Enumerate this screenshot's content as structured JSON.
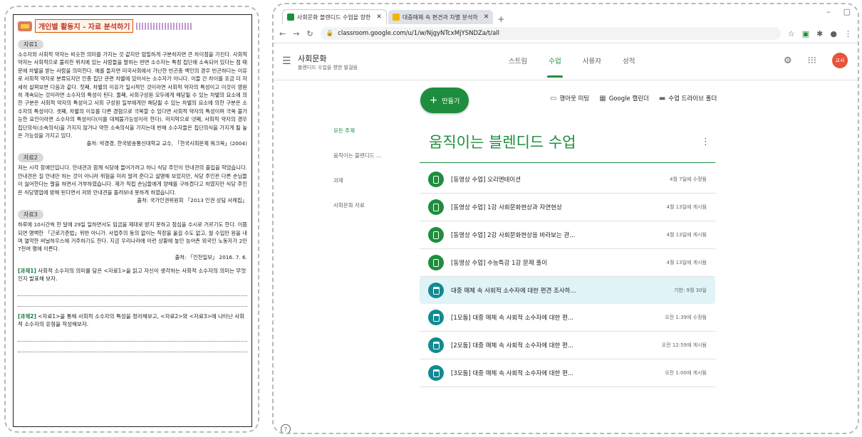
{
  "worksheet": {
    "title": "개인별 활동지 - 자료 분석하기",
    "material1_tag": "자료1",
    "material1_text": "소수자와 사회적 약자는 비슷한 의미를 가지는 것 같지만 엄밀하게 구분하자면 큰 차이점을 가진다. 사회적 약자는 사회적으로 불리한 위치에 있는 사람들을 말하는 반면 소수자는 특정 집단에 소속되어 있다는 점 때문에 차별을 받는 사람을 의미한다. 예를 들자면 미국사회에서 가난한 빈곤층 백인의 경우 빈곤하다는 이유로 사회적 약자로 분류되지만 인종 집단 관련 차별에 있어서는 소수자가 아니다. 이들 간 차이를 조금 더 자세히 살펴보면 다음과 같다. 첫째, 차별의 이유가 일시적인 것이라면 사회적 약자의 특성이고 이것이 영원히 계속되는 것이라면 소수자의 특성이 된다. 둘째, 사회구성원 모두에게 해당될 수 있는 차별의 요소에 의한 구분은 사회적 약자의 특성이고 사회 구성원 일부에게만 해당될 수 있는 차별의 요소에 의한 구분은 소수자의 특성이다. 셋째, 차별의 이유를 다른 경험으로 극복할 수 있다면 사회적 약자의 특성이며 극복 불가능한 요인이라면 소수자의 특성이다(이를 대체불가능성이라 한다). 마지막으로 넷째, 사회적 약자의 경우 집단의식(소속의식)을 가지지 않거나 약한 소속의식을 가지는데 반해 소수자들은 집단의식을 가지게 될 높은 가능성을 가지고 있다.",
    "material1_source": "출처: 박경경, 한국방송통신대학교 교수, 「한국사회문제 워크북」(2004)",
    "material2_tag": "자료2",
    "material2_text": "저는 시각 장애인입니다. 안내견과 함께 식당에 들어가려고 하니 식당 주인이 안내견의 출입을 막았습니다. 안내견은 길 안내만 하는 것이 아니라 위험을 미리 알려 준다고 설명해 보았지만, 식당 주인은 다른 손님들이 싫어한다는 말을 하면서 거부하였습니다. 제가 직접 손님들에게 양해를 구하겠다고 하였지만 식당 주인은 식당영업에 방해 된다면서 저와 안내견을 돌려보내 못하게 하였습니다.",
    "material2_source": "출처: 국가인권위원회 「2013 인권 상담 사례집」",
    "material3_tag": "자료3",
    "material3_text": "하루에 10시간씩 한 달에 29일 일하면서도 임금을 제대로 받지 못하고 점심을 수시로 거르기도 한다. 이쯤되면 명백한 「근로기준법」위반 아니가. 사업주의 동의 없이는 직장을 옮길 수도 없고, 월 수입만 원을 내며 열악한 비닐하우스에 거주하기도 한다. 지금 우리나라에 이런 상황에 놓인 농어촌 외국인 노동자가 2만 7천여 명에 이른다.",
    "material3_source": "출처: 「인천일보」 2016. 7. 6.",
    "task1_label": "[과제1]",
    "task1_text": "사회적 소수자의 의미를 담은 <자료1>을 읽고 자신이 생각하는 사회적 소수자의 의미는 무엇인지 발표해 보자.",
    "task2_label": "[과제2]",
    "task2_text": "<자료1>을 통해 사회적 소수자의 특성을 정리해보고, <자료2>와 <자료3>에 나타난 사회적 소수자의 유형을 작성해보자."
  },
  "browser": {
    "tabs": [
      {
        "label": "사회문화 블렌디드 수업을 향한",
        "color": "#1e8e3e"
      },
      {
        "label": "대중매체 속 편견과 차별 분석하",
        "color": "#f4b400"
      }
    ],
    "new_tab": "+",
    "url": "classroom.google.com/u/1/w/NjgyNTcxMjYSNDZa/t/all",
    "window_controls": [
      "–",
      "▢",
      "✕"
    ]
  },
  "classroom": {
    "class_name": "사회문화",
    "class_subtitle": "블렌디드 수업을 향한 발걸음",
    "nav_tabs": [
      "스트림",
      "수업",
      "사용자",
      "성적"
    ],
    "selected_tab": "수업",
    "avatar": "교사",
    "create_label": "만들기",
    "tools": [
      "행아웃 미팅",
      "Google 캘린더",
      "수업 드라이브 폴더"
    ],
    "side_nav": [
      "모든 주제",
      "움직이는 블렌디드 ...",
      "과제",
      "사회문화 자료"
    ],
    "topic_title": "움직이는 블렌디드 수업",
    "items": [
      {
        "title": "[동영상 수업] 오리엔테이션",
        "meta": "4월 7일에 수정됨",
        "kind": "material"
      },
      {
        "title": "[동영상 수업] 1강 사회문화현상과 자연현상",
        "meta": "4월 13일에 게시됨",
        "kind": "material"
      },
      {
        "title": "[동영상 수업] 2강 사회문화현상을 바라보는 관...",
        "meta": "4월 13일에 게시됨",
        "kind": "material"
      },
      {
        "title": "[동영상 수업] 수능특강 1강 문제 풀이",
        "meta": "4월 13일에 게시됨",
        "kind": "material"
      },
      {
        "title": "대중 매체 속 사회적 소수자에 대한 편견 조사하...",
        "meta": "기한: 9월 30일",
        "kind": "assignment"
      },
      {
        "title": "[1모둠] 대중 매체 속 사회적 소수자에 대한 편...",
        "meta": "오전 1:39에 수정됨",
        "kind": "assignment"
      },
      {
        "title": "[2모둠] 대중 매체 속 사회적 소수자에 대한 편...",
        "meta": "오전 12:59에 게시됨",
        "kind": "assignment"
      },
      {
        "title": "[3모둠] 대중 매체 속 사회적 소수자에 대한 편...",
        "meta": "오전 1:00에 게시됨",
        "kind": "assignment"
      }
    ]
  },
  "colors": {
    "accent": "#1e8e3e",
    "highlight_row": "#e0f3f7",
    "avatar": "#e8533a"
  }
}
